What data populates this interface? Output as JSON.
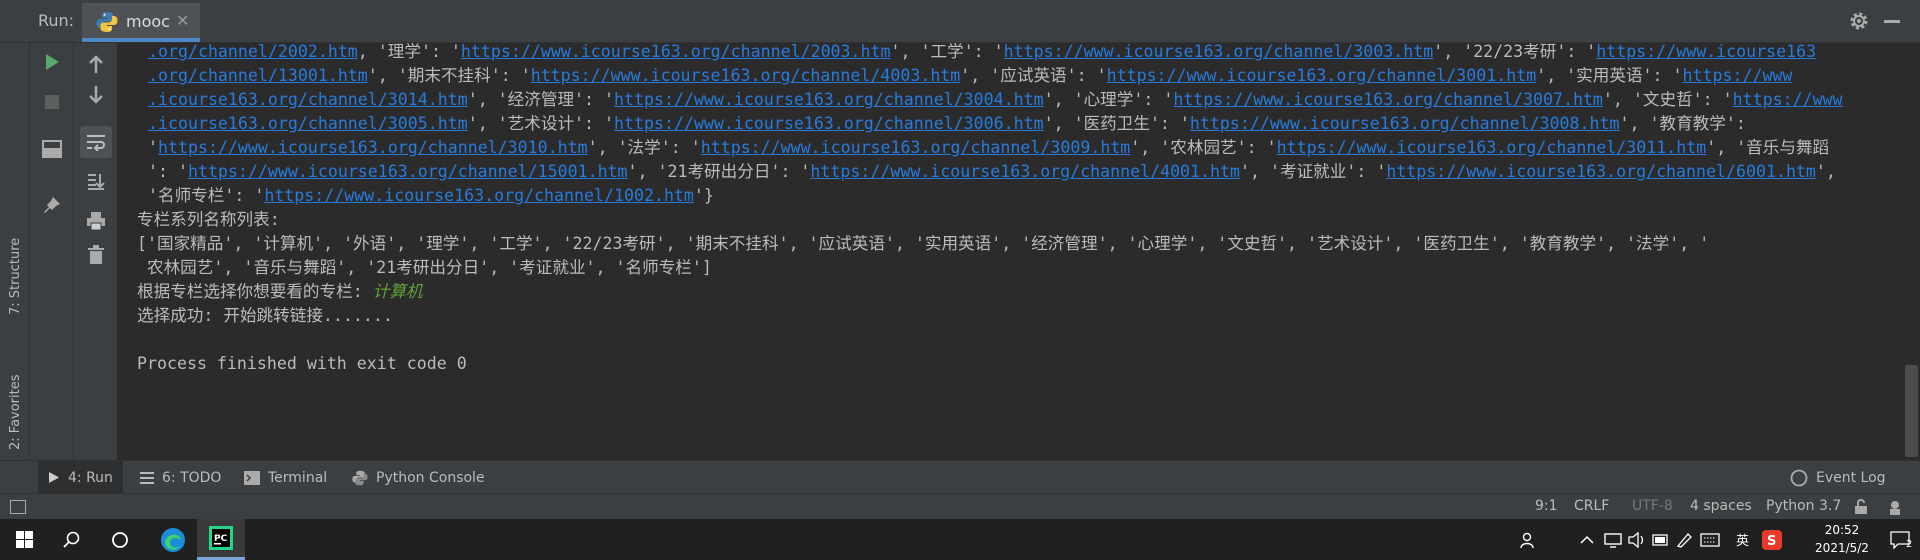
{
  "run_header": {
    "label": "Run:",
    "tab_label": "mooc",
    "tab_close": "✕"
  },
  "left_strip": {
    "structure_label": "7: Structure",
    "favorites_label": "2: Favorites"
  },
  "console": {
    "lines": [
      {
        "parts": [
          [
            ".org/channel/2002.htm",
            "l"
          ],
          [
            ", '理学': '",
            "t"
          ],
          [
            "https://www.icourse163.org/channel/2003.htm",
            "l"
          ],
          [
            "', '工学': '",
            "t"
          ],
          [
            "https://www.icourse163.org/channel/3003.htm",
            "l"
          ],
          [
            "', '22/23考研': '",
            "t"
          ],
          [
            "https://www.icourse163",
            "l"
          ]
        ]
      },
      {
        "parts": [
          [
            ".org/channel/13001.htm",
            "l"
          ],
          [
            "', '期末不挂科': '",
            "t"
          ],
          [
            "https://www.icourse163.org/channel/4003.htm",
            "l"
          ],
          [
            "', '应试英语': '",
            "t"
          ],
          [
            "https://www.icourse163.org/channel/3001.htm",
            "l"
          ],
          [
            "', '实用英语': '",
            "t"
          ],
          [
            "https://www",
            "l"
          ]
        ]
      },
      {
        "parts": [
          [
            ".icourse163.org/channel/3014.htm",
            "l"
          ],
          [
            "', '经济管理': '",
            "t"
          ],
          [
            "https://www.icourse163.org/channel/3004.htm",
            "l"
          ],
          [
            "', '心理学': '",
            "t"
          ],
          [
            "https://www.icourse163.org/channel/3007.htm",
            "l"
          ],
          [
            "', '文史哲': '",
            "t"
          ],
          [
            "https://www",
            "l"
          ]
        ]
      },
      {
        "parts": [
          [
            ".icourse163.org/channel/3005.htm",
            "l"
          ],
          [
            "', '艺术设计': '",
            "t"
          ],
          [
            "https://www.icourse163.org/channel/3006.htm",
            "l"
          ],
          [
            "', '医药卫生': '",
            "t"
          ],
          [
            "https://www.icourse163.org/channel/3008.htm",
            "l"
          ],
          [
            "', '教育教学':",
            "t"
          ]
        ]
      },
      {
        "parts": [
          [
            "'",
            "t"
          ],
          [
            "https://www.icourse163.org/channel/3010.htm",
            "l"
          ],
          [
            "', '法学': '",
            "t"
          ],
          [
            "https://www.icourse163.org/channel/3009.htm",
            "l"
          ],
          [
            "', '农林园艺': '",
            "t"
          ],
          [
            "https://www.icourse163.org/channel/3011.htm",
            "l"
          ],
          [
            "', '音乐与舞蹈",
            "t"
          ]
        ]
      },
      {
        "parts": [
          [
            "': '",
            "t"
          ],
          [
            "https://www.icourse163.org/channel/15001.htm",
            "l"
          ],
          [
            "', '21考研出分日': '",
            "t"
          ],
          [
            "https://www.icourse163.org/channel/4001.htm",
            "l"
          ],
          [
            "', '考证就业': '",
            "t"
          ],
          [
            "https://www.icourse163.org/channel/6001.htm",
            "l"
          ],
          [
            "',",
            "t"
          ]
        ]
      },
      {
        "parts": [
          [
            "'名师专栏': '",
            "t"
          ],
          [
            "https://www.icourse163.org/channel/1002.htm",
            "l"
          ],
          [
            "'}",
            "t"
          ]
        ]
      },
      {
        "parts": [
          [
            "专栏系列名称列表:",
            "t"
          ]
        ]
      },
      {
        "parts": [
          [
            "['国家精品', '计算机', '外语', '理学', '工学', '22/23考研', '期末不挂科', '应试英语', '实用英语', '经济管理', '心理学', '文史哲', '艺术设计', '医药卫生', '教育教学', '法学', '",
            "t"
          ]
        ]
      },
      {
        "parts": [
          [
            " 农林园艺', '音乐与舞蹈', '21考研出分日', '考证就业', '名师专栏']",
            "t"
          ]
        ]
      },
      {
        "parts": [
          [
            "根据专栏选择你想要看的专栏: ",
            "t"
          ],
          [
            "计算机",
            "g"
          ]
        ]
      },
      {
        "parts": [
          [
            "选择成功: 开始跳转链接.......",
            "t"
          ]
        ]
      },
      {
        "parts": [
          [
            "",
            "t"
          ]
        ]
      },
      {
        "parts": [
          [
            "Process finished with exit code 0",
            "t"
          ]
        ]
      }
    ]
  },
  "bottom_tabs": {
    "run": "4: Run",
    "todo": "6: TODO",
    "terminal": "Terminal",
    "python_console": "Python Console",
    "event_log": "Event Log"
  },
  "status_bar": {
    "position": "9:1",
    "line_sep": "CRLF",
    "encoding": "UTF-8",
    "indent": "4 spaces",
    "interpreter": "Python 3.7"
  },
  "taskbar": {
    "ime": "英",
    "time": "20:52",
    "date": "2021/5/2",
    "notifications": "2"
  },
  "icons": [
    "run-icon",
    "stop-icon",
    "layout-icon",
    "pin-icon",
    "rerun-up-icon",
    "down-icon",
    "soft-wrap-icon",
    "scroll-end-icon",
    "print-icon",
    "trash-icon",
    "gear-icon",
    "python-icon",
    "windows-start-icon",
    "search-icon",
    "cortana-icon",
    "edge-icon",
    "pycharm-icon"
  ],
  "colors": {
    "link": "#287bde",
    "green_input": "#62a337",
    "console_bg": "#2b2b2b",
    "panel_bg": "#3c3f41"
  }
}
